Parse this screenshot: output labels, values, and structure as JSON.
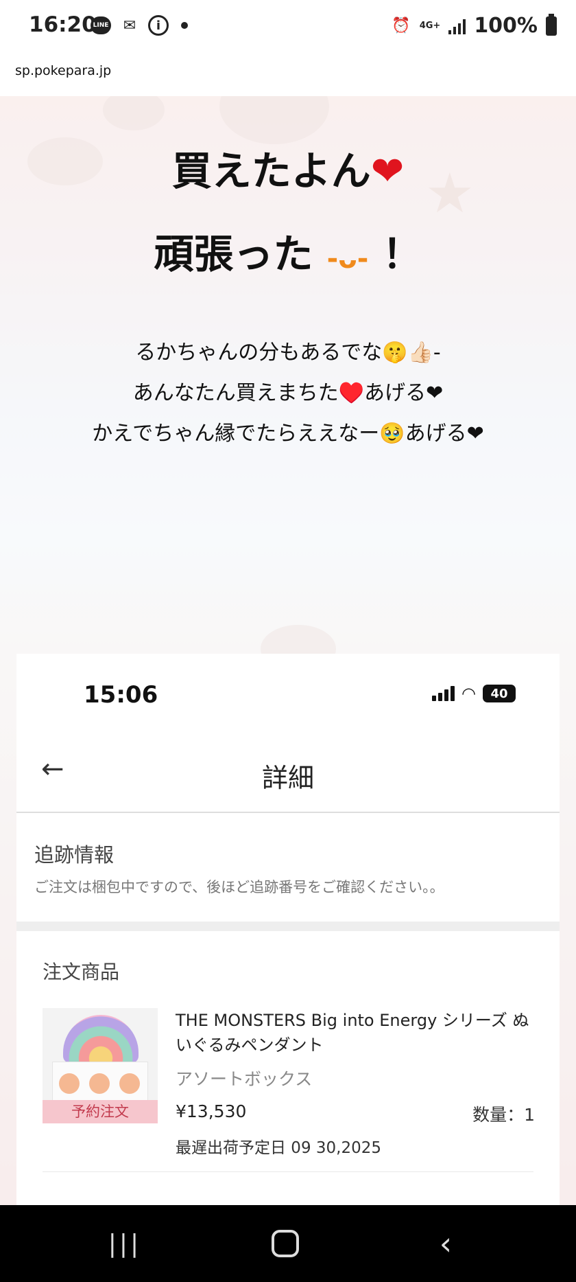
{
  "status_bar": {
    "time": "16:20",
    "left_icons": [
      "line-icon",
      "mail-icon",
      "info-icon",
      "notification-dot"
    ],
    "line_label": "LINE",
    "network": "4G+",
    "battery": "100%"
  },
  "url_bar": {
    "url": "sp.pokepara.jp"
  },
  "post": {
    "title_line1": "買えたよん",
    "title_line1_emoji": "❤",
    "title_line2": "頑張った",
    "title_line2_emoji": "-ᴗ-",
    "title_line2_end": "！",
    "messages": [
      "るかちゃんの分もあるでな🤫👍🏻-",
      "あんなたん買えまちた♥️あげる❤",
      "かえでちゃん縁でたらええなー🥹あげる❤"
    ]
  },
  "embedded_screenshot": {
    "status_time": "15:06",
    "battery": "40",
    "nav_title": "詳細",
    "tracking": {
      "title": "追跡情報",
      "note": "ご注文は梱包中ですので、後ほど追跡番号をご確認ください。。"
    },
    "order": {
      "title": "注文商品",
      "badge": "予約注文",
      "product_name": "THE MONSTERS Big into Energy シリーズ ぬいぐるみペンダント",
      "variant": "アソートボックス",
      "price": "¥13,530",
      "quantity": "数量：1",
      "ship_date": "最遅出荷予定日 09 30,2025"
    }
  },
  "nav_bar": {
    "buttons": [
      "recents-icon",
      "home-icon",
      "back-icon"
    ],
    "recents_glyph": "|||"
  }
}
